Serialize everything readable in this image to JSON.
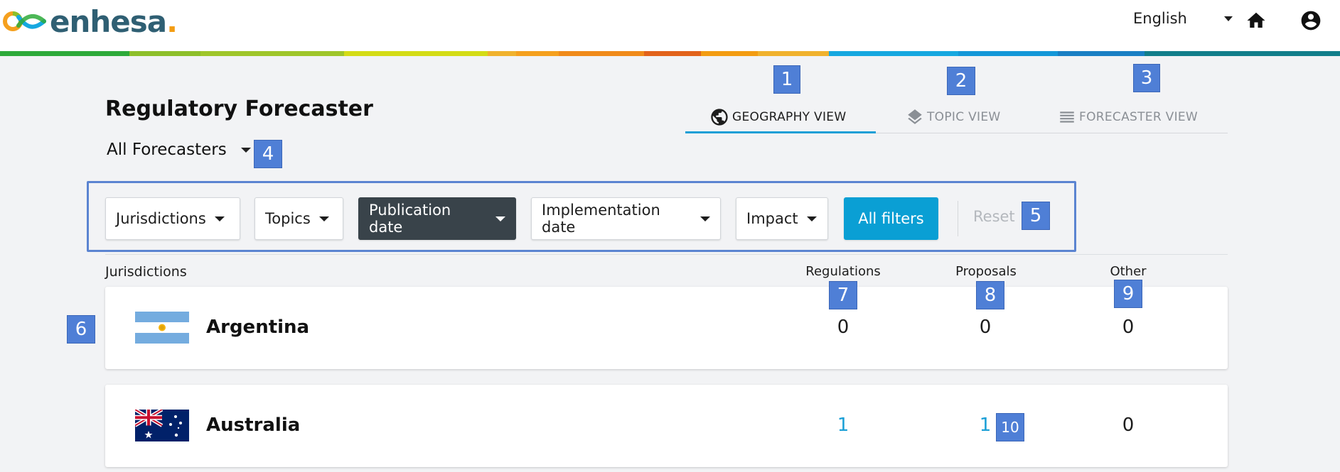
{
  "header": {
    "logo_text": "enhesa",
    "logo_dot": ".",
    "language": "English",
    "home_icon": "home-icon",
    "user_icon": "account-circle-icon",
    "rainbow_colors": [
      "#2eaa3a",
      "#8dbf2a",
      "#9fc62a",
      "#d4dc16",
      "#f0b22e",
      "#f5a01e",
      "#f08a1a",
      "#e2621b",
      "#f39c12",
      "#f0b22e",
      "#16a8e0",
      "#1497d8",
      "#1a7fc4",
      "#127e8a"
    ]
  },
  "page": {
    "title": "Regulatory Forecaster",
    "forecaster_select": "All Forecasters"
  },
  "tabs": [
    {
      "label": "GEOGRAPHY VIEW",
      "icon": "globe-icon",
      "active": true
    },
    {
      "label": "TOPIC VIEW",
      "icon": "layers-icon",
      "active": false
    },
    {
      "label": "FORECASTER VIEW",
      "icon": "list-icon",
      "active": false
    }
  ],
  "filters": {
    "jurisdictions": "Jurisdictions",
    "topics": "Topics",
    "publication_date": "Publication date",
    "implementation_date": "Implementation date",
    "impact": "Impact",
    "all_filters": "All filters",
    "reset": "Reset"
  },
  "table": {
    "headers": {
      "jurisdictions": "Jurisdictions",
      "regulations": "Regulations",
      "proposals": "Proposals",
      "other": "Other"
    },
    "rows": [
      {
        "country": "Argentina",
        "flag": "argentina-flag",
        "regulations": "0",
        "proposals": "0",
        "other": "0"
      },
      {
        "country": "Australia",
        "flag": "australia-flag",
        "regulations": "1",
        "proposals": "1",
        "other": "0"
      }
    ]
  },
  "annotations": [
    "1",
    "2",
    "3",
    "4",
    "5",
    "6",
    "7",
    "8",
    "9",
    "10"
  ],
  "colors": {
    "accent": "#1a9fd6",
    "dark_button": "#39434a",
    "badge": "#4f7fd6",
    "logo_text": "#2f5f73"
  }
}
